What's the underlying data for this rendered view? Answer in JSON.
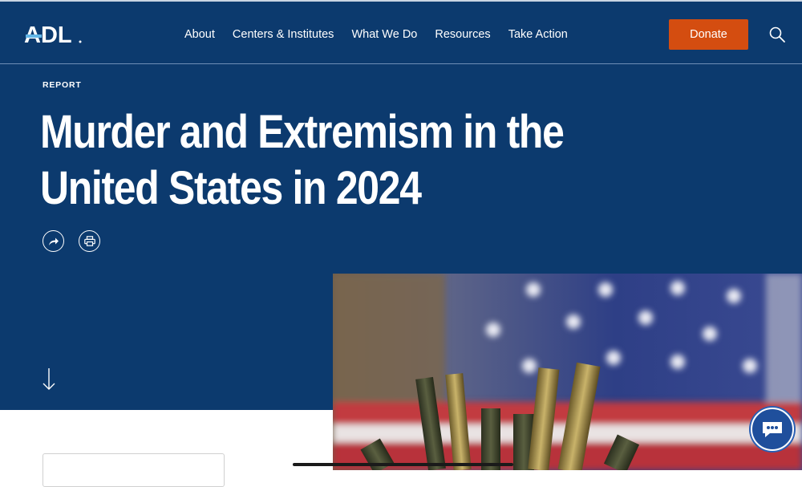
{
  "brand": {
    "logo_text": "ADL"
  },
  "nav": {
    "items": [
      {
        "label": "About"
      },
      {
        "label": "Centers & Institutes"
      },
      {
        "label": "What We Do"
      },
      {
        "label": "Resources"
      },
      {
        "label": "Take Action"
      }
    ],
    "donate_label": "Donate"
  },
  "hero": {
    "eyebrow": "REPORT",
    "title": "Murder and Extremism in the United States in 2024"
  },
  "colors": {
    "navy": "#0c3a6e",
    "donate_orange": "#d44d10",
    "logo_accent": "#62b6e7"
  },
  "icons": {
    "share": "share-arrow-icon",
    "print": "printer-icon",
    "scroll": "arrow-down-icon",
    "search": "search-icon",
    "chat": "chat-bubble-icon"
  },
  "image": {
    "subject": "bullet casings in front of an American flag"
  }
}
